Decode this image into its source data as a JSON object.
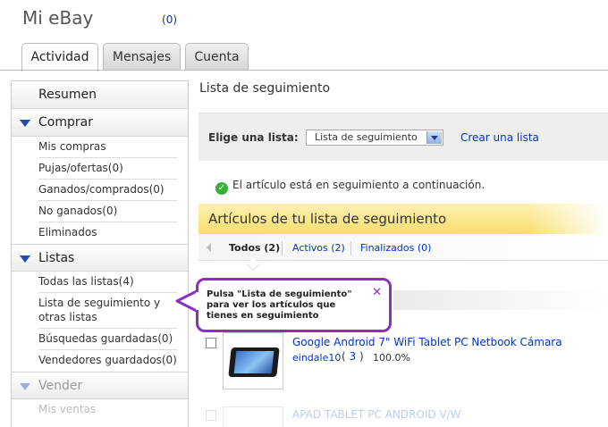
{
  "header": {
    "title": "Mi eBay",
    "count_open": "(",
    "count": "0",
    "count_close": ")"
  },
  "tabs": [
    {
      "label": "Actividad",
      "active": true
    },
    {
      "label": "Mensajes",
      "active": false
    },
    {
      "label": "Cuenta",
      "active": false
    }
  ],
  "sidebar": {
    "summary": "Resumen",
    "buy": {
      "title": "Comprar",
      "items": [
        "Mis compras",
        "Pujas/ofertas(0)",
        "Ganados/comprados(0)",
        "No ganados(0)",
        "Eliminados"
      ]
    },
    "lists": {
      "title": "Listas",
      "items": [
        "Todas las listas(4)",
        "Lista de seguimiento y otras listas",
        "Búsquedas guardadas(0)",
        "Vendedores guardados(0)"
      ]
    },
    "sell": {
      "title": "Vender",
      "items": [
        "Mis ventas"
      ]
    }
  },
  "main": {
    "title": "Lista de seguimiento",
    "filter_label": "Elige una lista:",
    "select_value": "Lista de seguimiento",
    "create_link": "Crear una lista",
    "success_message": "El artículo está en seguimiento a continuación.",
    "section_title": "Artículos de tu lista de seguimiento",
    "subtabs": [
      {
        "label": "Todos (2)",
        "active": true
      },
      {
        "label": "Activos (2)",
        "active": false
      },
      {
        "label": "Finalizados (0)",
        "active": false
      }
    ],
    "item": {
      "title": "Google Android 7\" WiFi Tablet PC Netbook Cámara",
      "seller": "eindale10",
      "score_open": "(",
      "score": "3",
      "score_close": ")",
      "feedback_pct": "100.0%"
    },
    "faded_item_title": "APAD TABLET PC ANDROID V/W"
  },
  "callout": {
    "text": "Pulsa \"Lista de seguimiento\" para ver los artículos que tienes en seguimiento",
    "close": "✕"
  },
  "colors": {
    "link": "#0033cc",
    "accent_triangle": "#1a4db3",
    "callout_border": "#8a2fc4",
    "section_band": "#f8de6a",
    "success": "#3cae3a"
  }
}
